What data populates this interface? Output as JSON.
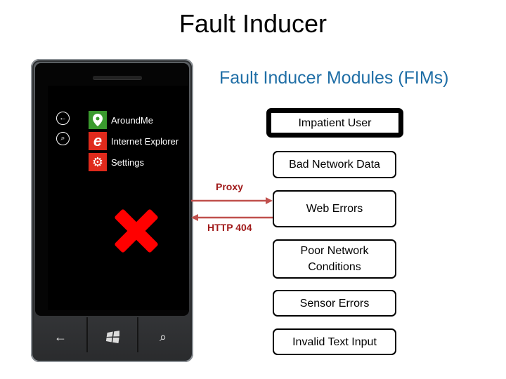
{
  "title": "Fault Inducer",
  "subtitle": "Fault Inducer Modules (FIMs)",
  "phone": {
    "side_icons": [
      {
        "name": "back-arrow-icon",
        "glyph": "←"
      },
      {
        "name": "search-icon",
        "glyph": "⌕"
      }
    ],
    "apps": [
      {
        "label": "AroundMe",
        "icon": "map-pin-icon",
        "glyph": "⬤",
        "color": "#3a9a2e"
      },
      {
        "label": "Internet Explorer",
        "icon": "ie-logo-icon",
        "glyph": "e",
        "color": "#e02a1c"
      },
      {
        "label": "Settings",
        "icon": "gear-icon",
        "glyph": "⚙",
        "color": "#e02a1c"
      }
    ],
    "error_mark": "red-x-icon",
    "hardware_buttons": [
      {
        "name": "back",
        "glyph": "←"
      },
      {
        "name": "windows-start",
        "glyph": "⊞"
      },
      {
        "name": "search",
        "glyph": "⌕"
      }
    ]
  },
  "connections": {
    "request_label": "Proxy",
    "response_label": "HTTP 404",
    "arrow_color": "#c0504d",
    "label_color": "#a01a1a"
  },
  "modules": [
    {
      "label": "Impatient User",
      "active": true
    },
    {
      "label": "Bad Network Data",
      "active": false
    },
    {
      "label": "Web Errors",
      "active": false
    },
    {
      "label": "Poor Network Conditions",
      "active": false
    },
    {
      "label": "Sensor Errors",
      "active": false
    },
    {
      "label": "Invalid Text Input",
      "active": false
    }
  ]
}
